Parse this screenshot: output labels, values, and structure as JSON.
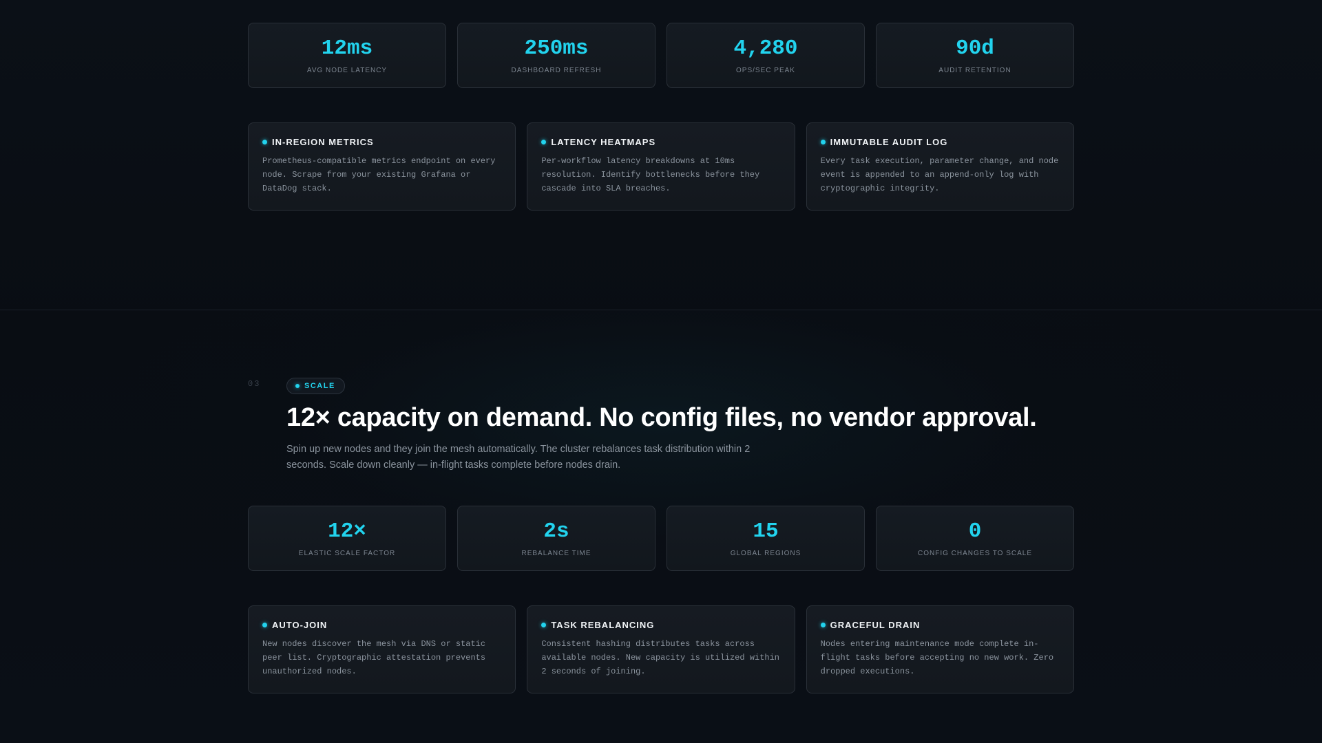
{
  "top_stats": [
    {
      "value": "12ms",
      "label": "AVG NODE LATENCY"
    },
    {
      "value": "250ms",
      "label": "DASHBOARD REFRESH"
    },
    {
      "value": "4,280",
      "label": "OPS/SEC PEAK"
    },
    {
      "value": "90d",
      "label": "AUDIT RETENTION"
    }
  ],
  "top_features": [
    {
      "title": "IN-REGION METRICS",
      "desc": "Prometheus-compatible metrics endpoint on every node. Scrape from your existing Grafana or DataDog stack."
    },
    {
      "title": "LATENCY HEATMAPS",
      "desc": "Per-workflow latency breakdowns at 10ms resolution. Identify bottlenecks before they cascade into SLA breaches."
    },
    {
      "title": "IMMUTABLE AUDIT LOG",
      "desc": "Every task execution, parameter change, and node event is appended to an append-only log with cryptographic integrity."
    }
  ],
  "scale_section": {
    "number": "03",
    "tag": "SCALE",
    "headline": "12× capacity on demand. No config files, no vendor approval.",
    "subtext": "Spin up new nodes and they join the mesh automatically. The cluster rebalances task distribution within 2 seconds. Scale down cleanly — in-flight tasks complete before nodes drain."
  },
  "scale_stats": [
    {
      "value": "12×",
      "label": "ELASTIC SCALE FACTOR"
    },
    {
      "value": "2s",
      "label": "REBALANCE TIME"
    },
    {
      "value": "15",
      "label": "GLOBAL REGIONS"
    },
    {
      "value": "0",
      "label": "CONFIG CHANGES TO SCALE"
    }
  ],
  "scale_features": [
    {
      "title": "AUTO-JOIN",
      "desc": "New nodes discover the mesh via DNS or static peer list. Cryptographic attestation prevents unauthorized nodes."
    },
    {
      "title": "TASK REBALANCING",
      "desc": "Consistent hashing distributes tasks across available nodes. New capacity is utilized within 2 seconds of joining."
    },
    {
      "title": "GRACEFUL DRAIN",
      "desc": "Nodes entering maintenance mode complete in-flight tasks before accepting no new work. Zero dropped executions."
    }
  ],
  "colors": {
    "accent": "#22d3ee",
    "background": "#0a0e14",
    "card": "#151b22",
    "border": "#2a3038"
  }
}
